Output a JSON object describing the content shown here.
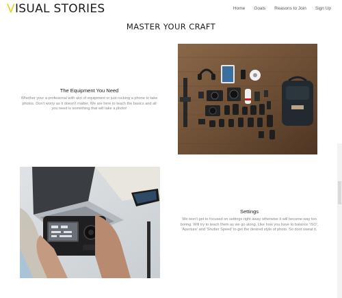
{
  "brand": {
    "first_letter": "V",
    "rest": "ISUAL STORIES"
  },
  "nav": {
    "items": [
      "Home",
      "Goals",
      "Reasons to Join",
      "Sign Up"
    ]
  },
  "section": {
    "title": "MASTER YOUR CRAFT"
  },
  "features": [
    {
      "heading": "The Equipment You Need",
      "body": "Whether your a profesional with alot of equipment or just rocking a phone to take photos. Don't worry as it doesn't matter. We are here to teach the basics and all you need is something that will take a photo!"
    },
    {
      "heading": "Settings",
      "body": "We won't get to focused on settings right away otherwise it will become way too boring. Will try to teach them as we go along. Like how you have to balance 'ISO', 'Aperture' and 'Shutter Speed' to get the desired style of photo. So dont sweat it."
    }
  ],
  "colors": {
    "accent": "#e8cc18",
    "text": "#222222",
    "muted": "#888888",
    "wood": "#7a5a3e"
  }
}
